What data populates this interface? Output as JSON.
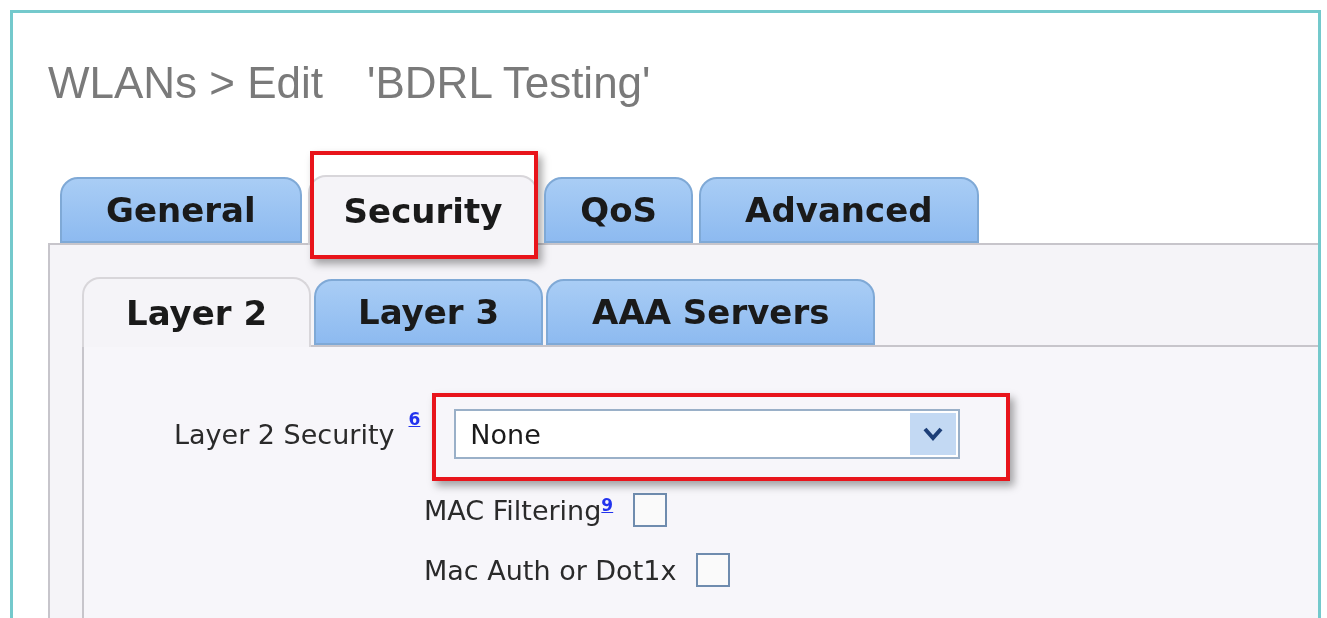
{
  "page": {
    "title": "WLANs > Edit",
    "subject": "'BDRL Testing'"
  },
  "tabs": [
    {
      "label": "General",
      "selected": false,
      "highlighted": false
    },
    {
      "label": "Security",
      "selected": true,
      "highlighted": true
    },
    {
      "label": "QoS",
      "selected": false,
      "highlighted": false
    },
    {
      "label": "Advanced",
      "selected": false,
      "highlighted": false
    }
  ],
  "subtabs": [
    {
      "label": "Layer 2",
      "selected": true
    },
    {
      "label": "Layer 3",
      "selected": false
    },
    {
      "label": "AAA Servers",
      "selected": false
    }
  ],
  "security": {
    "label": "Layer 2 Security",
    "footnote": "6",
    "select": {
      "value": "None",
      "highlighted": true
    }
  },
  "options": [
    {
      "label": "MAC Filtering",
      "footnote": "9",
      "checked": false
    },
    {
      "label": "Mac Auth or Dot1x",
      "checked": false
    }
  ]
}
